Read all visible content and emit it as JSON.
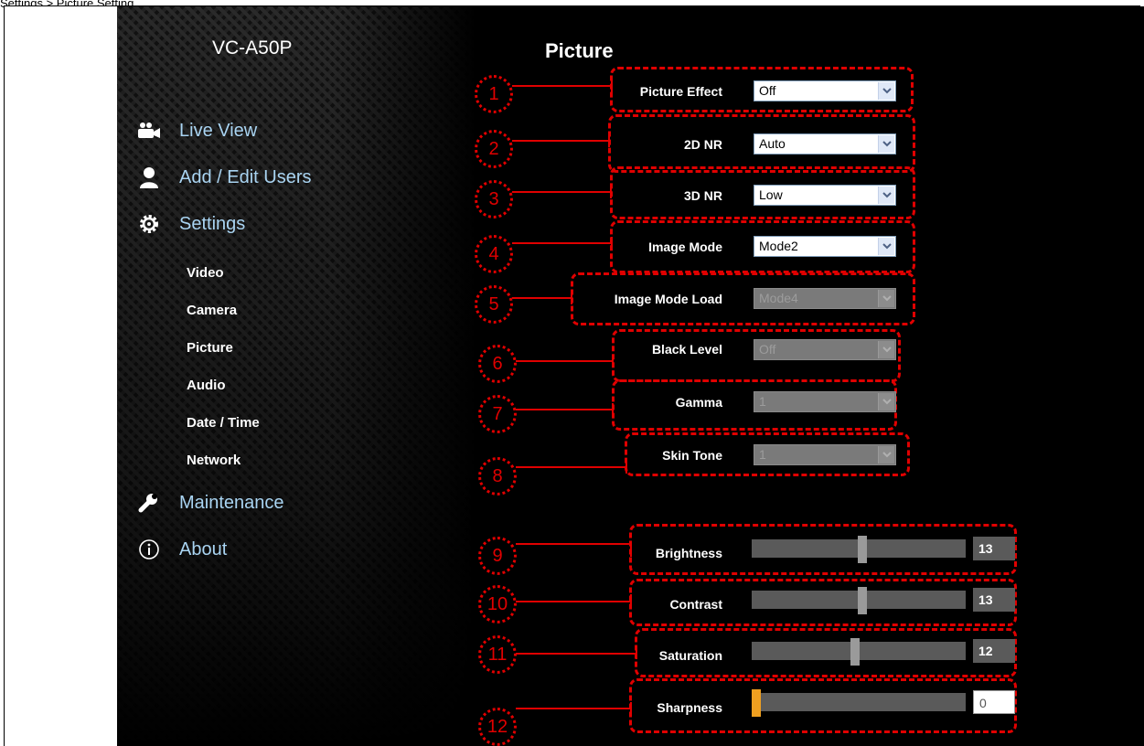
{
  "caption": "Settings > Picture Setting",
  "brand": "VC-A50P",
  "nav": {
    "live_view": "Live View",
    "users": "Add / Edit Users",
    "settings": "Settings",
    "sub": [
      "Video",
      "Camera",
      "Picture",
      "Audio",
      "Date / Time",
      "Network"
    ],
    "maintenance": "Maintenance",
    "about": "About"
  },
  "page_title": "Picture",
  "fields": [
    {
      "num": "1",
      "label": "Picture Effect",
      "value": "Off",
      "disabled": false
    },
    {
      "num": "2",
      "label": "2D NR",
      "value": "Auto",
      "disabled": false
    },
    {
      "num": "3",
      "label": "3D NR",
      "value": "Low",
      "disabled": false
    },
    {
      "num": "4",
      "label": "Image Mode",
      "value": "Mode2",
      "disabled": false
    },
    {
      "num": "5",
      "label": "Image Mode Load",
      "value": "Mode4",
      "disabled": true
    },
    {
      "num": "6",
      "label": "Black Level",
      "value": "Off",
      "disabled": true
    },
    {
      "num": "7",
      "label": "Gamma",
      "value": "1",
      "disabled": true
    },
    {
      "num": "8",
      "label": "Skin Tone",
      "value": "1",
      "disabled": true
    }
  ],
  "sliders": [
    {
      "num": "9",
      "label": "Brightness",
      "value": "13",
      "level": 0.52
    },
    {
      "num": "10",
      "label": "Contrast",
      "value": "13",
      "level": 0.52
    },
    {
      "num": "11",
      "label": "Saturation",
      "value": "12",
      "level": 0.48
    },
    {
      "num": "12",
      "label": "Sharpness",
      "value": "0",
      "level": 0.0
    }
  ],
  "colors": {
    "annotation": "#e00000",
    "nav_text": "#a9d4f2",
    "slider_min_thumb": "#f0a020"
  },
  "icons": {
    "live_view": "camera-people-icon",
    "users": "user-icon",
    "settings": "gear-icon",
    "maintenance": "wrench-icon",
    "about": "info-icon",
    "dropdown": "chevron-down-icon"
  }
}
